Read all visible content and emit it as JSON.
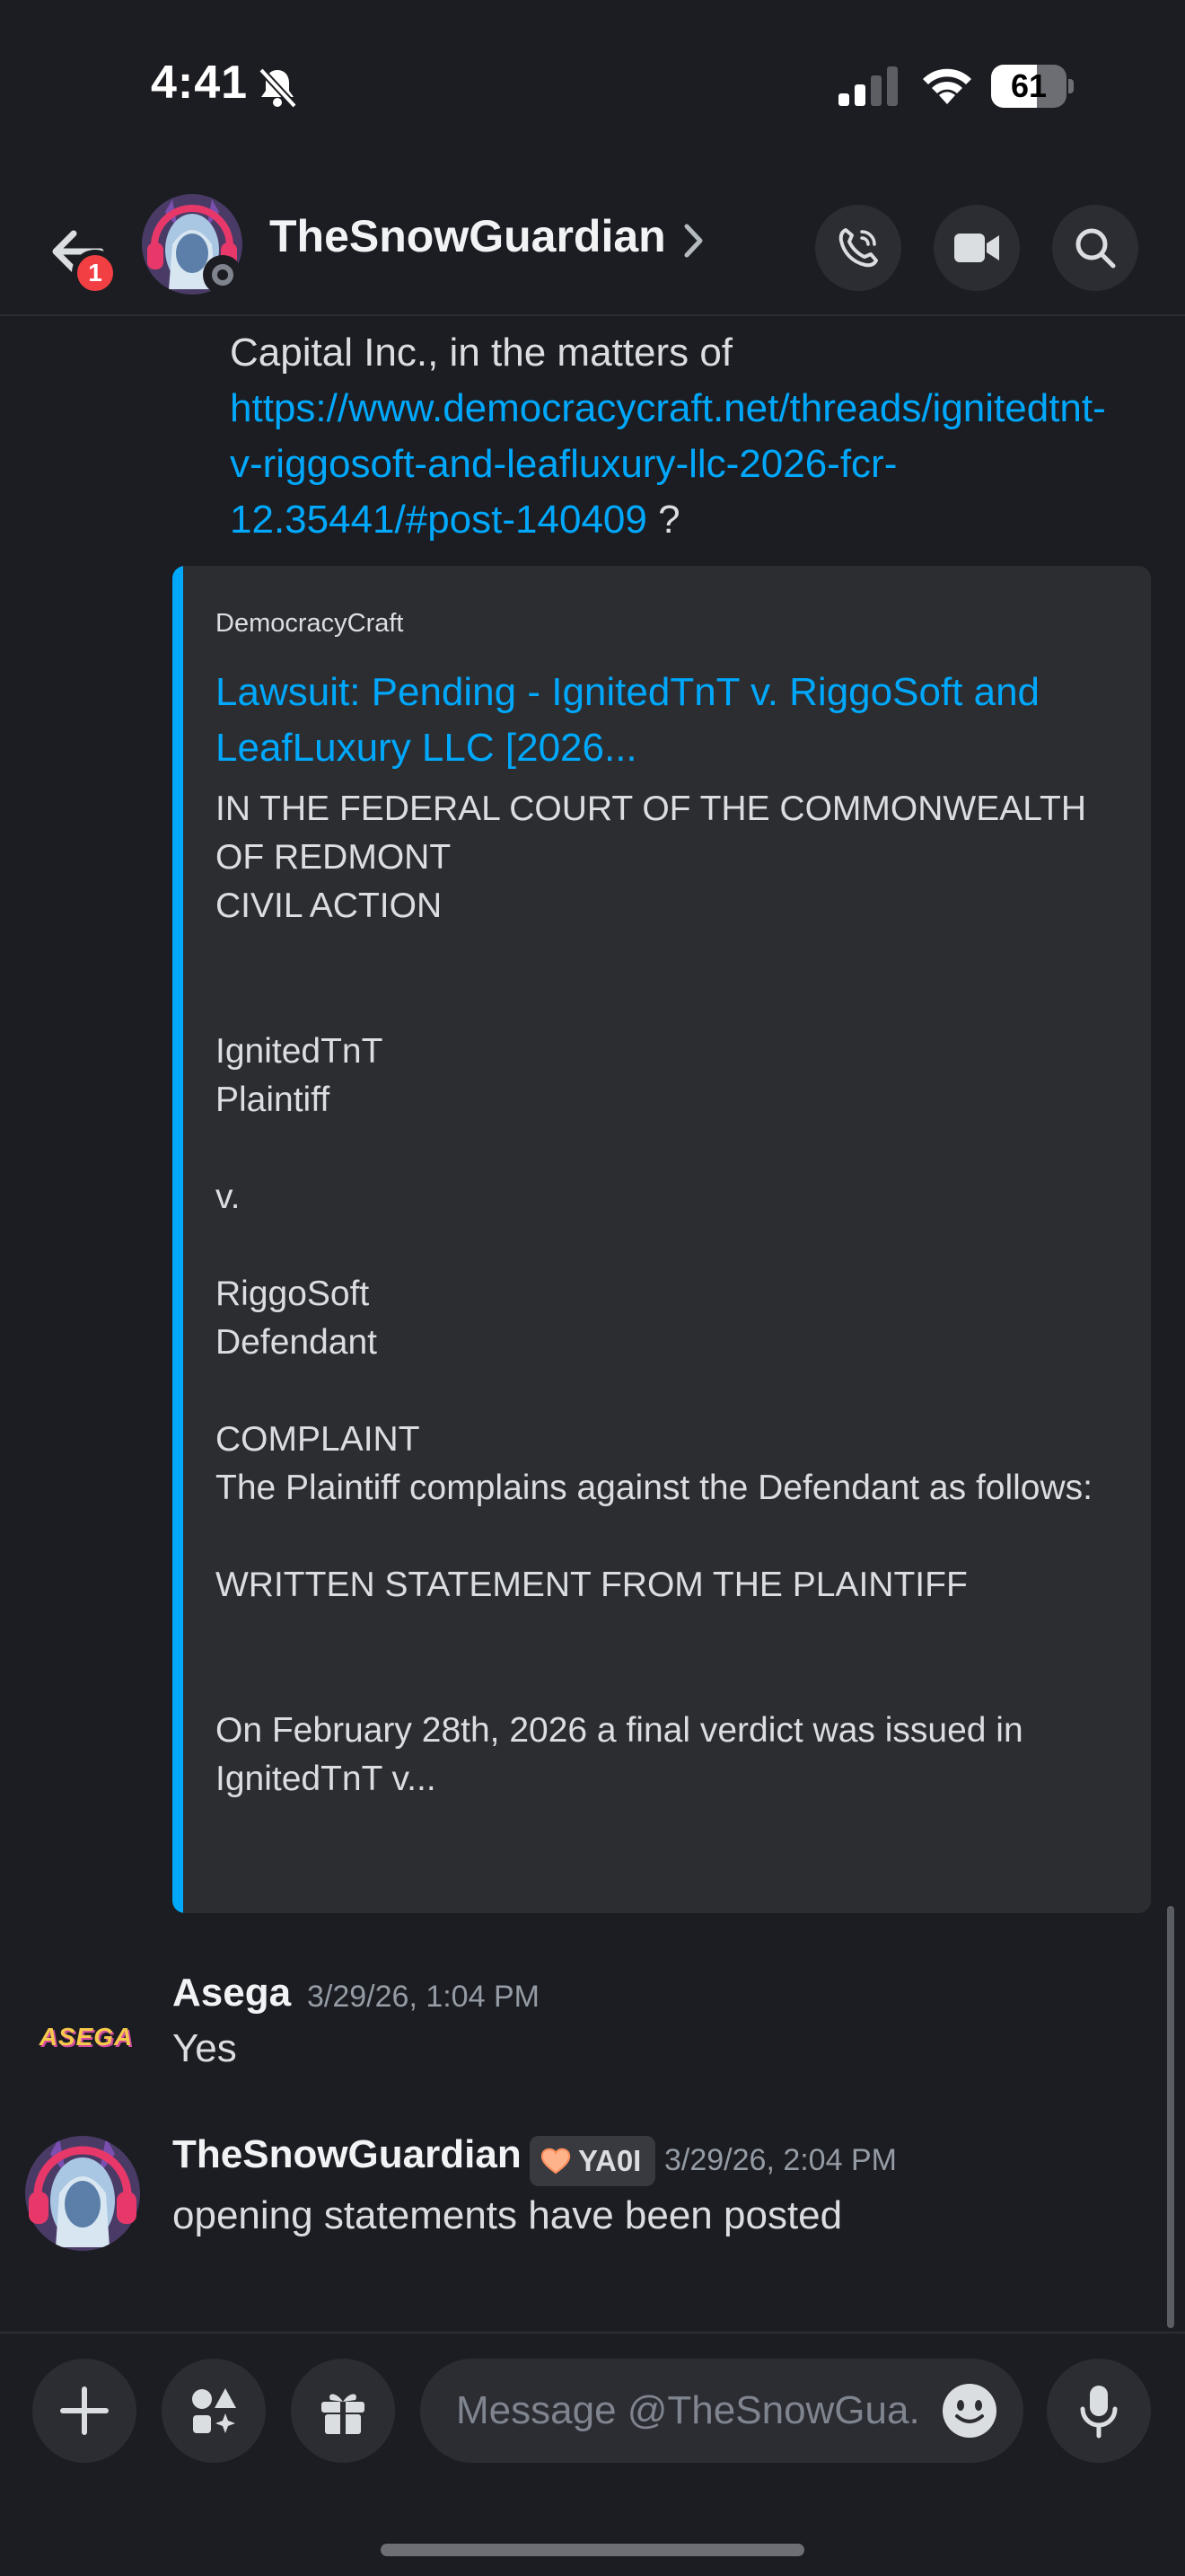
{
  "status_bar": {
    "time": "4:41",
    "battery": "61",
    "battery_level": 0.61
  },
  "header": {
    "back_badge": "1",
    "title": "TheSnowGuardian"
  },
  "messages": {
    "continued": {
      "text_prefix": "Capital Inc., in the matters of ",
      "link": "https://www.democracycraft.net/threads/ignitedtnt-v-riggosoft-and-leafluxury-llc-2026-fcr-12.35441/#post-140409",
      "text_suffix": " ?"
    },
    "embed": {
      "provider": "DemocracyCraft",
      "title": "Lawsuit: Pending - IgnitedTnT v. RiggoSoft and LeafLuxury LLC [2026...",
      "description": "IN THE FEDERAL COURT OF THE COMMONWEALTH OF REDMONT\nCIVIL ACTION\n\n\nIgnitedTnT\nPlaintiff\n\nv.\n\nRiggoSoft\nDefendant\n\nCOMPLAINT\nThe Plaintiff complains against the Defendant as follows:\n\nWRITTEN STATEMENT FROM THE PLAINTIFF\n\n\nOn February 28th, 2026 a final verdict was issued in IgnitedTnT v..."
    },
    "asega": {
      "avatar_text": "ASEGA",
      "author": "Asega",
      "timestamp": "3/29/26, 1:04 PM",
      "text": "Yes"
    },
    "snow": {
      "author": "TheSnowGuardian",
      "tag": "YA0I",
      "tag_icon": "peach-heart-icon",
      "timestamp": "3/29/26, 2:04 PM",
      "text": "opening statements have been posted"
    }
  },
  "composer": {
    "placeholder": "Message @TheSnowGua.."
  },
  "colors": {
    "background": "#1c1d22",
    "accent_link": "#00a8fc",
    "badge_red": "#f23f43",
    "embed_bg": "#2b2d31"
  }
}
